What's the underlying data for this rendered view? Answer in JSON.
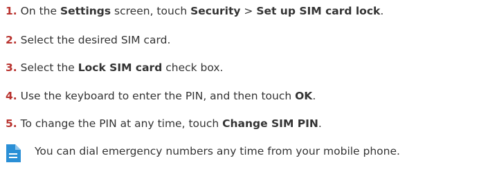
{
  "steps": [
    {
      "number": "1.",
      "parts": [
        "On the ",
        "Settings",
        " screen, touch ",
        "Security",
        " > ",
        "Set up SIM card lock",
        "."
      ]
    },
    {
      "number": "2.",
      "parts": [
        "Select the desired SIM card."
      ]
    },
    {
      "number": "3.",
      "parts": [
        "Select the ",
        "Lock SIM card",
        " check box."
      ]
    },
    {
      "number": "4.",
      "parts": [
        "Use the keyboard to enter the PIN, and then touch ",
        "OK",
        "."
      ]
    },
    {
      "number": "5.",
      "parts": [
        "To change the PIN at any time, touch ",
        "Change SIM PIN",
        "."
      ]
    }
  ],
  "note": {
    "icon": "note-icon",
    "text": "You can dial emergency numbers any time from your mobile phone."
  },
  "colors": {
    "step_number": "#b8322e",
    "text": "#333333",
    "note_icon": "#2a8fd6"
  }
}
